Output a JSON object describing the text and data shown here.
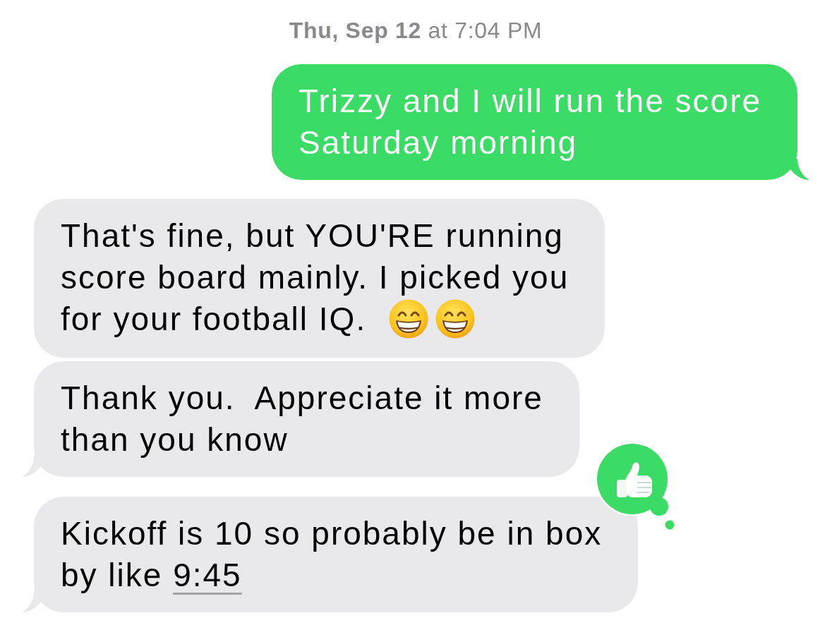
{
  "timestamp": "**Thu, Sep 12** at 7:04 PM",
  "messages": [
    {
      "outgoing": true,
      "tail": true,
      "lines": [
        "Trizzy and I will run the score",
        "Saturday morning"
      ]
    },
    {
      "outgoing": false,
      "tail": false,
      "lines": [
        "That's fine, but YOU'RE running",
        "score board mainly. I picked you",
        "for your football IQ."
      ],
      "emojis": [
        {
          "kind": "grin"
        },
        {
          "kind": "grin"
        }
      ]
    },
    {
      "outgoing": false,
      "tail": true,
      "lines": [
        "Thank you.  Appreciate it more",
        "than you know"
      ]
    },
    {
      "outgoing": false,
      "tail": true,
      "lines": [
        "Kickoff is 10 so probably be in box",
        "by like"
      ],
      "link": "9:45",
      "reaction": {
        "kind": "thumbs-up"
      }
    }
  ]
}
